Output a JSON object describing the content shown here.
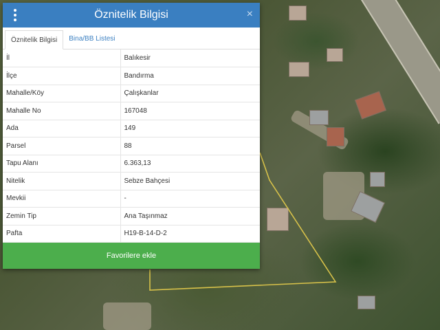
{
  "dialog": {
    "title": "Öznitelik Bilgisi",
    "close_label": "×",
    "tabs": [
      {
        "label": "Öznitelik Bilgisi",
        "active": true
      },
      {
        "label": "Bina/BB Listesi",
        "active": false
      }
    ],
    "rows": [
      {
        "key": "İl",
        "value": "Balıkesir"
      },
      {
        "key": "İlçe",
        "value": "Bandırma"
      },
      {
        "key": "Mahalle/Köy",
        "value": "Çalışkanlar"
      },
      {
        "key": "Mahalle No",
        "value": "167048"
      },
      {
        "key": "Ada",
        "value": "149"
      },
      {
        "key": "Parsel",
        "value": "88"
      },
      {
        "key": "Tapu Alanı",
        "value": "6.363,13"
      },
      {
        "key": "Nitelik",
        "value": "Sebze Bahçesi"
      },
      {
        "key": "Mevkii",
        "value": "-"
      },
      {
        "key": "Zemin Tip",
        "value": "Ana Taşınmaz"
      },
      {
        "key": "Pafta",
        "value": "H19-B-14-D-2"
      }
    ],
    "favorite_button": "Favorilere ekle"
  },
  "colors": {
    "header": "#3a7fc1",
    "favorite_button": "#4cae4c",
    "parcel_outline": "#d8c24a"
  },
  "icons": {
    "menu": "vertical-dots-icon",
    "close": "close-icon"
  }
}
